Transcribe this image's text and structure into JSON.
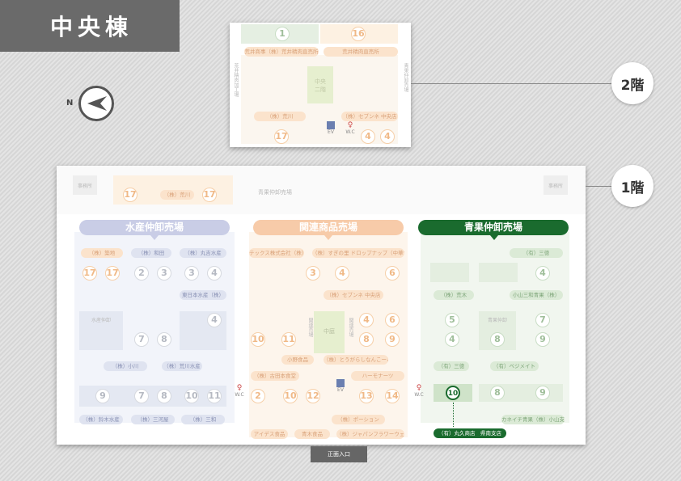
{
  "title": "中央棟",
  "north": "N",
  "floor2": {
    "label": "2階",
    "nums_top": [
      "1",
      "16"
    ],
    "pills_top": [
      "荒井商事（株）荒井精肉直売所",
      "荒井精肉直売所"
    ],
    "center_box": "中央\n二階",
    "side_left": "荒井精肉加工場",
    "side_right": "青果仲卸売場",
    "pills_bottom": [
      "（株）荒川",
      "（株）セブンネ 中央店"
    ],
    "nums_bottom": [
      "17",
      "4",
      "4"
    ],
    "ev": "EV",
    "wc": "W.C"
  },
  "floor1": {
    "label": "1階",
    "top_left_box": "事務所",
    "top_right_box": "事務所",
    "top_center": "青果仲卸売場",
    "top_pill": "（株）荒川",
    "top_nums": [
      "17",
      "17"
    ],
    "sections": {
      "seafood": "水産仲卸売場",
      "related": "関連商品売場",
      "produce": "青果仲卸売場"
    },
    "seafood": {
      "pills_r1": [
        "（株）築地",
        "（株）和田",
        "（株）丸吉水産"
      ],
      "nums_r1": [
        "17",
        "17",
        "2",
        "3",
        "3",
        "4"
      ],
      "pill_r2": "東日本水産（株）",
      "box_label": "水産仲卸",
      "nums_r2": [
        "7",
        "8",
        "4"
      ],
      "pills_r3": [
        "（株）小川",
        "（株）荒川水産"
      ],
      "nums_r3": [
        "9",
        "7",
        "8",
        "10",
        "11"
      ],
      "pills_r4": [
        "（株）鈴木水産",
        "（株）三河屋",
        "（株）三和"
      ]
    },
    "related": {
      "pills_r1": [
        "テックス株式会社（株）",
        "（株）すぎの里 ドロップナップ（中華食品）"
      ],
      "nums_r1": [
        "3",
        "4",
        "6"
      ],
      "pill_r2": "（株）セブンネ 中央店",
      "box_label": "中庭",
      "side_left": "関連売場",
      "side_right": "関連売場",
      "nums_r2": [
        "4",
        "6",
        "10",
        "11",
        "8",
        "9"
      ],
      "pills_r3": [
        "小野食品",
        "（株）とうがらしなんこーど"
      ],
      "pills_r4": [
        "（株）古田本食堂",
        "ハーモナーツ"
      ],
      "nums_r4": [
        "2",
        "10",
        "12",
        "13",
        "14"
      ],
      "pills_r5": [
        "（株）ポーション"
      ],
      "pills_r6": [
        "アイデス食品",
        "青木食品",
        "（株）ジャパンフラワーウェイ"
      ]
    },
    "produce": {
      "pill_r1": "（有）三徳",
      "nums_r1": [
        "4"
      ],
      "pills_r2": [
        "（株）荒木",
        "小山三和青果（株）"
      ],
      "box_label": "青果仲卸",
      "nums_r2": [
        "5",
        "7",
        "4",
        "8",
        "9"
      ],
      "pills_r3": [
        "（有）三徳",
        "（有）ベジメイト"
      ],
      "nums_r3": [
        "10",
        "8",
        "9"
      ],
      "pill_r4": "カネイチ青果（株）小山支社",
      "active_pill": "（有）丸久商店　県南支店"
    },
    "ev": "EV",
    "wc": "W.C",
    "entrance": "正面入口"
  },
  "colors": {
    "active_green": "#1a6b2e",
    "title_bg": "#6a6a6a"
  }
}
